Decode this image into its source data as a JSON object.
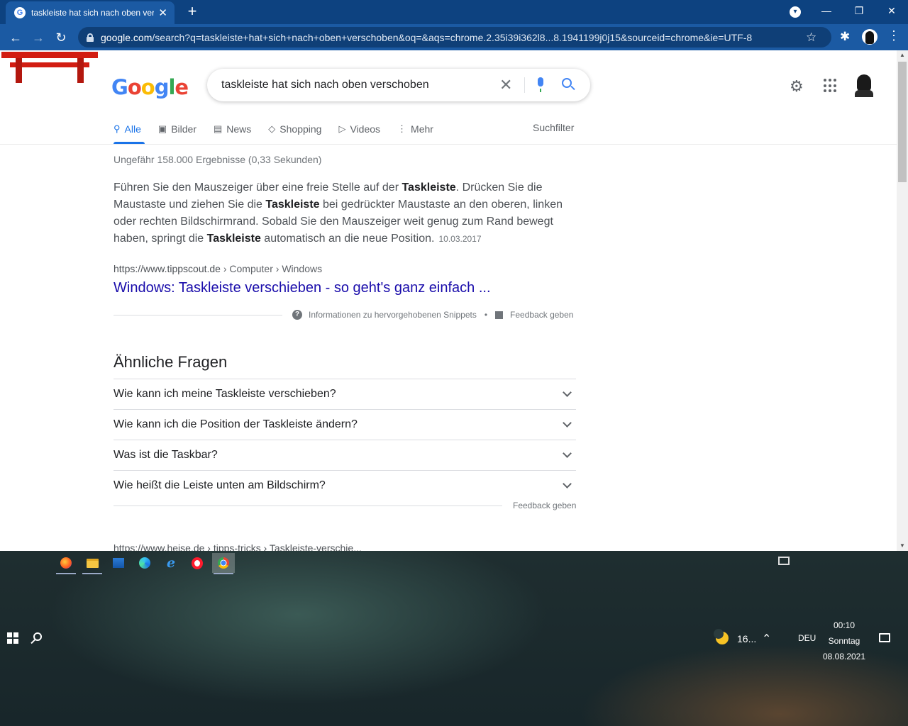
{
  "browser": {
    "tab_title": "taskleiste hat sich nach oben verschoben - Google Suche",
    "tab_close": "✕",
    "new_tab": "+",
    "url_domain": "google.com",
    "url_path": "/search?q=taskleiste+hat+sich+nach+oben+verschoben&oq=&aqs=chrome.2.35i39i362l8...8.1941199j0j15&sourceid=chrome&ie=UTF-8"
  },
  "google": {
    "logo_letters": [
      "G",
      "o",
      "o",
      "g",
      "l",
      "e"
    ],
    "query": "taskleiste hat sich nach oben verschoben",
    "tabs": [
      {
        "label": "Alle",
        "icon": "search-icon"
      },
      {
        "label": "Bilder",
        "icon": "image-icon"
      },
      {
        "label": "News",
        "icon": "news-icon"
      },
      {
        "label": "Shopping",
        "icon": "tag-icon"
      },
      {
        "label": "Videos",
        "icon": "video-icon"
      },
      {
        "label": "Mehr",
        "icon": "more-vert-icon"
      }
    ],
    "tools": "Suchfilter",
    "stats": "Ungefähr 158.000 Ergebnisse (0,33 Sekunden)",
    "snippet": {
      "p1": "Führen Sie den Mauszeiger über eine freie Stelle auf der ",
      "b1": "Taskleiste",
      "p2": ". Drücken Sie die Maustaste und ziehen Sie die ",
      "b2": "Taskleiste",
      "p3": " bei gedrückter Maustaste an den oberen, linken oder rechten Bildschirmrand. Sobald Sie den Mauszeiger weit genug zum Rand bewegt haben, springt die ",
      "b3": "Taskleiste",
      "p4": " automatisch an die neue Position.",
      "date": "10.03.2017",
      "cite_domain": "https://www.tippscout.de",
      "cite_path": " › Computer › Windows",
      "title": "Windows: Taskleiste verschieben - so geht's ganz einfach ...",
      "info_label": "Informationen zu hervorgehobenen Snippets",
      "feedback": "Feedback geben"
    },
    "paa": {
      "title": "Ähnliche Fragen",
      "questions": [
        "Wie kann ich meine Taskleiste verschieben?",
        "Wie kann ich die Position der Taskleiste ändern?",
        "Was ist die Taskbar?",
        "Wie heißt die Leiste unten am Bildschirm?"
      ],
      "feedback": "Feedback geben"
    },
    "next_cite": "https://www.heise.de › tipps-tricks › Taskleiste-verschie..."
  },
  "taskbar": {
    "weather": "16...",
    "language": "DEU",
    "time": "00:10",
    "day": "Sonntag",
    "date": "08.08.2021",
    "apps": [
      "firefox",
      "file-explorer",
      "photos",
      "edge",
      "internet-explorer",
      "opera",
      "chrome"
    ]
  }
}
